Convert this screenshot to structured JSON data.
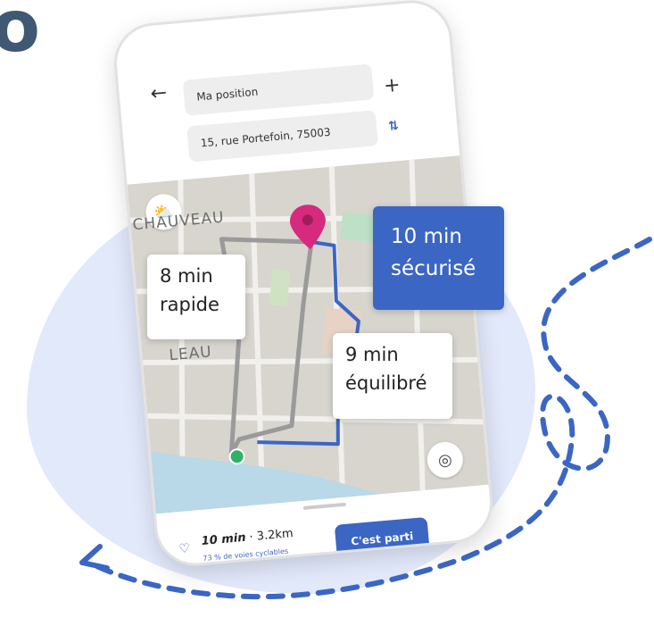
{
  "brand": {
    "partial_letter": "o"
  },
  "search": {
    "from_placeholder": "Ma position",
    "to_value": "15, rue Portefoin, 75003"
  },
  "map": {
    "street_labels": [
      "CHAUVEAU",
      "LEAU"
    ]
  },
  "routes": {
    "fast": {
      "time": "8 min",
      "label": "rapide"
    },
    "balanced": {
      "time": "9 min",
      "label": "équilibré"
    },
    "safe": {
      "time": "10 min",
      "label": "sécurisé",
      "color": "#3b66c4"
    }
  },
  "summary": {
    "duration": "10 min",
    "distance": "· 3.2km",
    "cycle_note": "73 % de voies cyclables",
    "go_label": "C'est parti"
  },
  "icons": {
    "back": "arrow-left-icon",
    "add": "plus-icon",
    "swap": "swap-vertical-icon",
    "weather": "cloud-sun-icon",
    "locate": "locate-icon",
    "destination": "map-pin-icon",
    "favorite": "heart-icon"
  },
  "colors": {
    "accent": "#3b66c4",
    "pin": "#d52a7d",
    "start": "#2fb266",
    "route_fast": "#9a9a9a",
    "brand_text": "#3f5873",
    "blob": "#e2e9fb"
  }
}
